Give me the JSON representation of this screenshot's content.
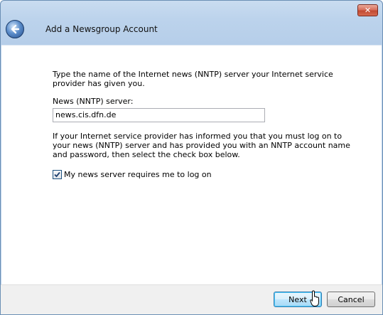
{
  "window": {
    "close_label": "✕"
  },
  "header": {
    "title": "Add a Newsgroup Account"
  },
  "main": {
    "intro": "Type the name of the Internet news (NNTP) server your Internet service provider has given you.",
    "server_label": "News (NNTP) server:",
    "server_value": "news.cis.dfn.de",
    "logon_note": "If your Internet service provider has informed you that you must log on to your news (NNTP) server and has provided you with an NNTP account name and password, then select the check box below.",
    "checkbox_label": "My news server requires me to log on",
    "checkbox_checked": true
  },
  "footer": {
    "next_label": "Next",
    "cancel_label": "Cancel"
  },
  "colors": {
    "accent": "#3c7fb1",
    "close": "#c14a33"
  }
}
